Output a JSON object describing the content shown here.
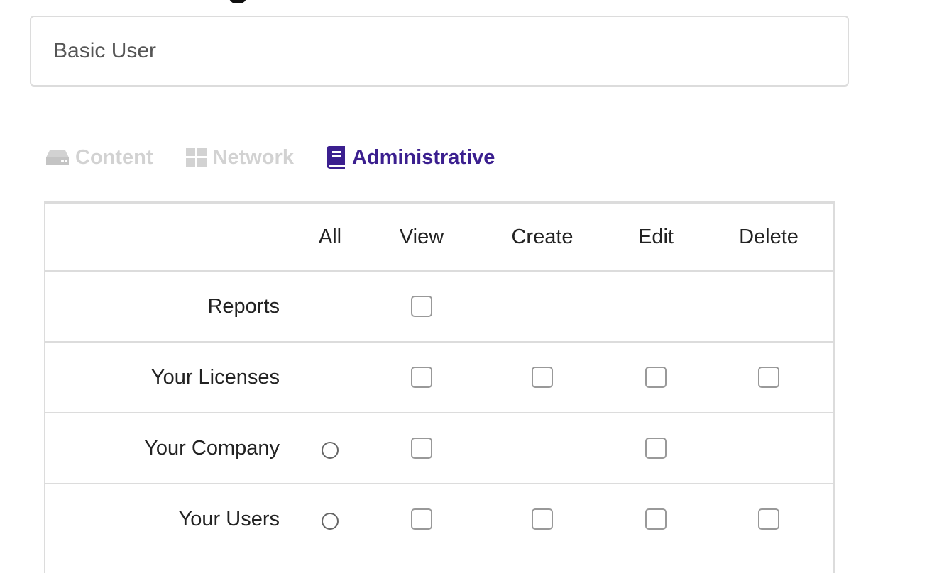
{
  "role_name": {
    "value": "Basic User"
  },
  "tabs": [
    {
      "label": "Content",
      "icon": "hdd-icon",
      "active": false,
      "color": "#d2d2d2"
    },
    {
      "label": "Network",
      "icon": "grid-icon",
      "active": false,
      "color": "#d2d2d2"
    },
    {
      "label": "Administrative",
      "icon": "book-icon",
      "active": true,
      "color": "#3b1f8f"
    }
  ],
  "permissions_table": {
    "columns": [
      "All",
      "View",
      "Create",
      "Edit",
      "Delete"
    ],
    "rows": [
      {
        "label": "Reports",
        "all": null,
        "view": false,
        "create": null,
        "edit": null,
        "delete": null
      },
      {
        "label": "Your Licenses",
        "all": null,
        "view": false,
        "create": false,
        "edit": false,
        "delete": false
      },
      {
        "label": "Your Company",
        "all": false,
        "view": false,
        "create": null,
        "edit": false,
        "delete": null
      },
      {
        "label": "Your Users",
        "all": false,
        "view": false,
        "create": false,
        "edit": false,
        "delete": false
      }
    ]
  }
}
